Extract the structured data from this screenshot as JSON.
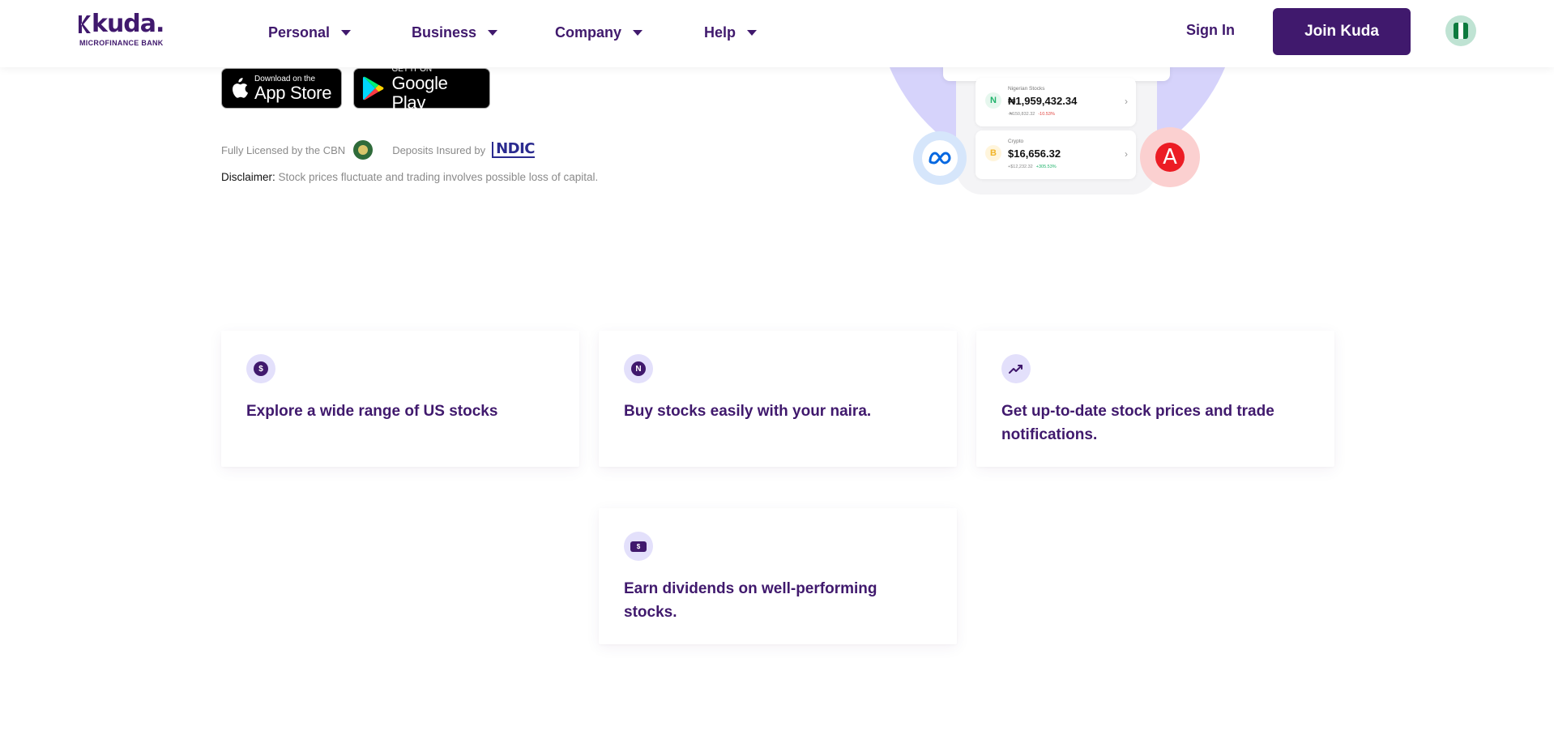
{
  "brand": {
    "logo_text": "kuda.",
    "logo_sub": "MICROFINANCE BANK"
  },
  "nav": {
    "items": [
      {
        "label": "Personal"
      },
      {
        "label": "Business"
      },
      {
        "label": "Company"
      },
      {
        "label": "Help"
      }
    ],
    "sign_in": "Sign In",
    "join": "Join Kuda",
    "country": "Nigeria"
  },
  "stores": {
    "apple_small": "Download on the",
    "apple_big": "App Store",
    "google_small": "GET IT ON",
    "google_big": "Google Play"
  },
  "license": {
    "cbn_text": "Fully Licensed by the CBN",
    "ndic_text": "Deposits Insured by",
    "ndic_logo": "NDIC"
  },
  "disclaimer": {
    "label": "Disclaimer:",
    "text": "Stock prices fluctuate and trading involves possible loss of capital."
  },
  "illustration": {
    "assets": [
      {
        "label": "Nigerian Stocks",
        "value": "₦1,959,432.34",
        "change_abs": "-₦150,832.32",
        "change_pct": "-10.53%",
        "icon": "N"
      },
      {
        "label": "Crypto",
        "value": "$16,656.32",
        "change_abs": "+$12,232.32",
        "change_pct": "+305.53%",
        "icon": "B"
      }
    ],
    "adobe_letter": "A"
  },
  "features": [
    {
      "title": "Explore a wide range of US stocks",
      "icon": "dollar-coin-icon",
      "glyph": "$"
    },
    {
      "title": "Buy stocks easily with your naira.",
      "icon": "naira-coin-icon",
      "glyph": "N"
    },
    {
      "title": "Get up-to-date stock prices and trade notifications.",
      "icon": "trend-up-icon"
    },
    {
      "title": "Earn dividends on well-performing stocks.",
      "icon": "cash-note-icon",
      "glyph": "$"
    }
  ],
  "colors": {
    "brand_purple": "#40196d",
    "icon_bg": "#e3e0fb",
    "illus_bg": "#d6d3fb"
  }
}
